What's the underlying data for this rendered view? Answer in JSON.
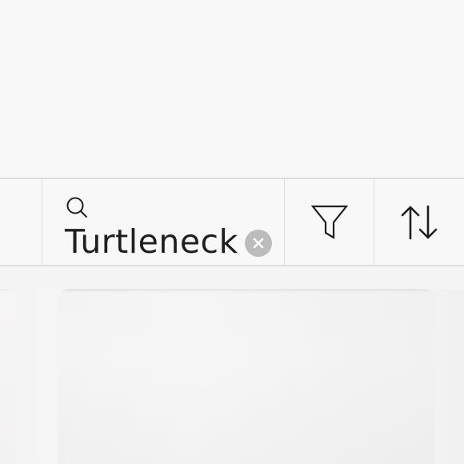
{
  "search": {
    "value": "Turtleneck",
    "icon": "search-icon",
    "clear_icon": "clear-icon"
  },
  "toolbar": {
    "filter_icon": "filter-icon",
    "sort_icon": "sort-icon"
  },
  "colors": {
    "background": "#f9f8f8",
    "divider": "#dedddd",
    "text": "#1f1f1f",
    "clear_button": "#bcbcbc"
  }
}
